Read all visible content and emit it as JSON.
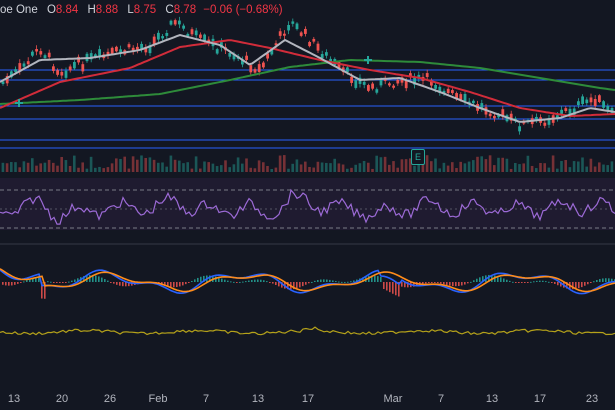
{
  "legend": {
    "title": "oe One",
    "o_label": "O",
    "o_value": "8.84",
    "h_label": "H",
    "h_value": "8.88",
    "l_label": "L",
    "l_value": "8.75",
    "c_label": "C",
    "c_value": "8.78",
    "change": "−0.06 (−0.68%)"
  },
  "earnings_badge": "E",
  "x_axis": {
    "ticks": [
      {
        "label": "13"
      },
      {
        "label": "20"
      },
      {
        "label": "26"
      },
      {
        "label": "Feb"
      },
      {
        "label": "7"
      },
      {
        "label": "13"
      },
      {
        "label": "17"
      },
      {
        "label": "Mar"
      },
      {
        "label": "7"
      },
      {
        "label": "13"
      },
      {
        "label": "17"
      },
      {
        "label": "23"
      }
    ]
  },
  "colors": {
    "up": "#26a69a",
    "down": "#ef5350",
    "ma_fast": "#b2b5be",
    "ma_mid": "#d12c3a",
    "ma_slow": "#2e8b3a",
    "rsi": "#9c6ad6",
    "macd": "#2962ff",
    "signal": "#ff8c1a",
    "lower": "#b5a21a"
  }
}
